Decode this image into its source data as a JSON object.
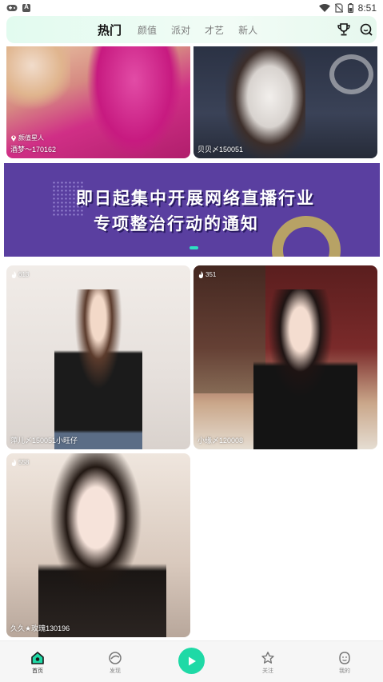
{
  "status_bar": {
    "time": "8:51",
    "left_icons": [
      "game-icon",
      "a-icon"
    ],
    "right_icons": [
      "wifi-icon",
      "no-sim-icon",
      "battery-icon"
    ]
  },
  "topnav": {
    "tabs": [
      "热门",
      "颜值",
      "派对",
      "才艺",
      "新人"
    ],
    "active_tab": "热门",
    "icons": [
      "trophy-icon",
      "search-icon"
    ],
    "accent_color": "#22d6a3"
  },
  "cards": [
    {
      "caption": "酒梦〜170162",
      "location": "颜值星人"
    },
    {
      "caption": "贝贝〆150051"
    },
    {
      "caption": "萍儿〆150051小旺仔",
      "count": "613"
    },
    {
      "caption": "小缘〆120008",
      "count": "351"
    },
    {
      "caption": "久久★玫瑰130196",
      "count": "558"
    }
  ],
  "banner": {
    "line1": "即日起集中开展网络直播行业",
    "line2": "专项整治行动的通知",
    "bg_color": "#5a3fa0"
  },
  "bottom_nav": {
    "items": [
      {
        "label": "首页",
        "icon": "home-icon"
      },
      {
        "label": "发现",
        "icon": "discover-icon"
      },
      {
        "label": "",
        "icon": "play-icon"
      },
      {
        "label": "关注",
        "icon": "star-icon"
      },
      {
        "label": "我的",
        "icon": "profile-icon"
      }
    ],
    "active": "首页"
  }
}
